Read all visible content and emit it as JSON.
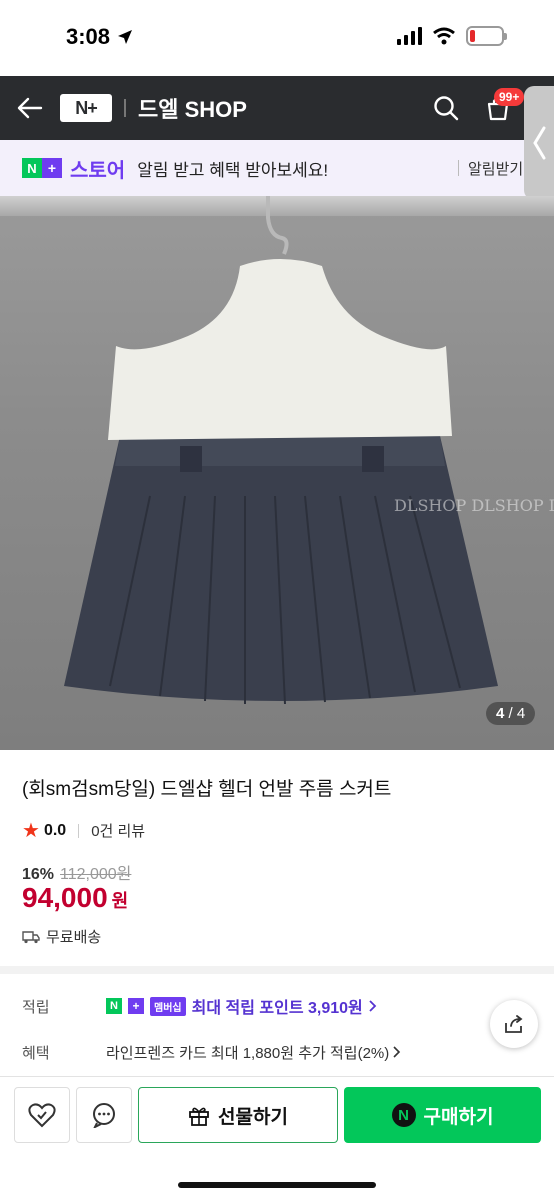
{
  "status": {
    "time": "3:08",
    "battery_level": 0.15,
    "battery_color": "#e5292b"
  },
  "header": {
    "logo_text": "N+",
    "shop_name": "드엘 SHOP",
    "cart_badge": "99+",
    "bg_color": "#2a2c2f"
  },
  "notice": {
    "n_label": "N",
    "plus_label": "+",
    "store_label": "스토어",
    "text": "알림 받고 혜택 받아보세요!",
    "action": "알림받기"
  },
  "gallery": {
    "watermark": "DLSHOP DLSHOP DL",
    "current": "4",
    "separator": "/",
    "total": "4"
  },
  "product": {
    "title": "(회sm검sm당일) 드엘샵 헬더 언발 주름 스커트",
    "rating": "0.0",
    "review_count": "0건 리뷰",
    "discount": "16%",
    "original_price": "112,000원",
    "price": "94,000",
    "price_unit": "원",
    "delivery": "무료배송"
  },
  "benefits": {
    "points_label": "적립",
    "membership_badge": "멤버십",
    "points_text": "최대 적립 포인트 3,910원",
    "benefit_label": "혜택",
    "benefit_text": "라인프렌즈 카드 최대 1,880원 추가 적립(2%)"
  },
  "bottom_bar": {
    "gift_label": "선물하기",
    "buy_label": "구매하기",
    "npay_label": "N"
  },
  "colors": {
    "accent_green": "#03c75a",
    "accent_purple": "#6f3cf0",
    "price_red": "#c2002f"
  }
}
